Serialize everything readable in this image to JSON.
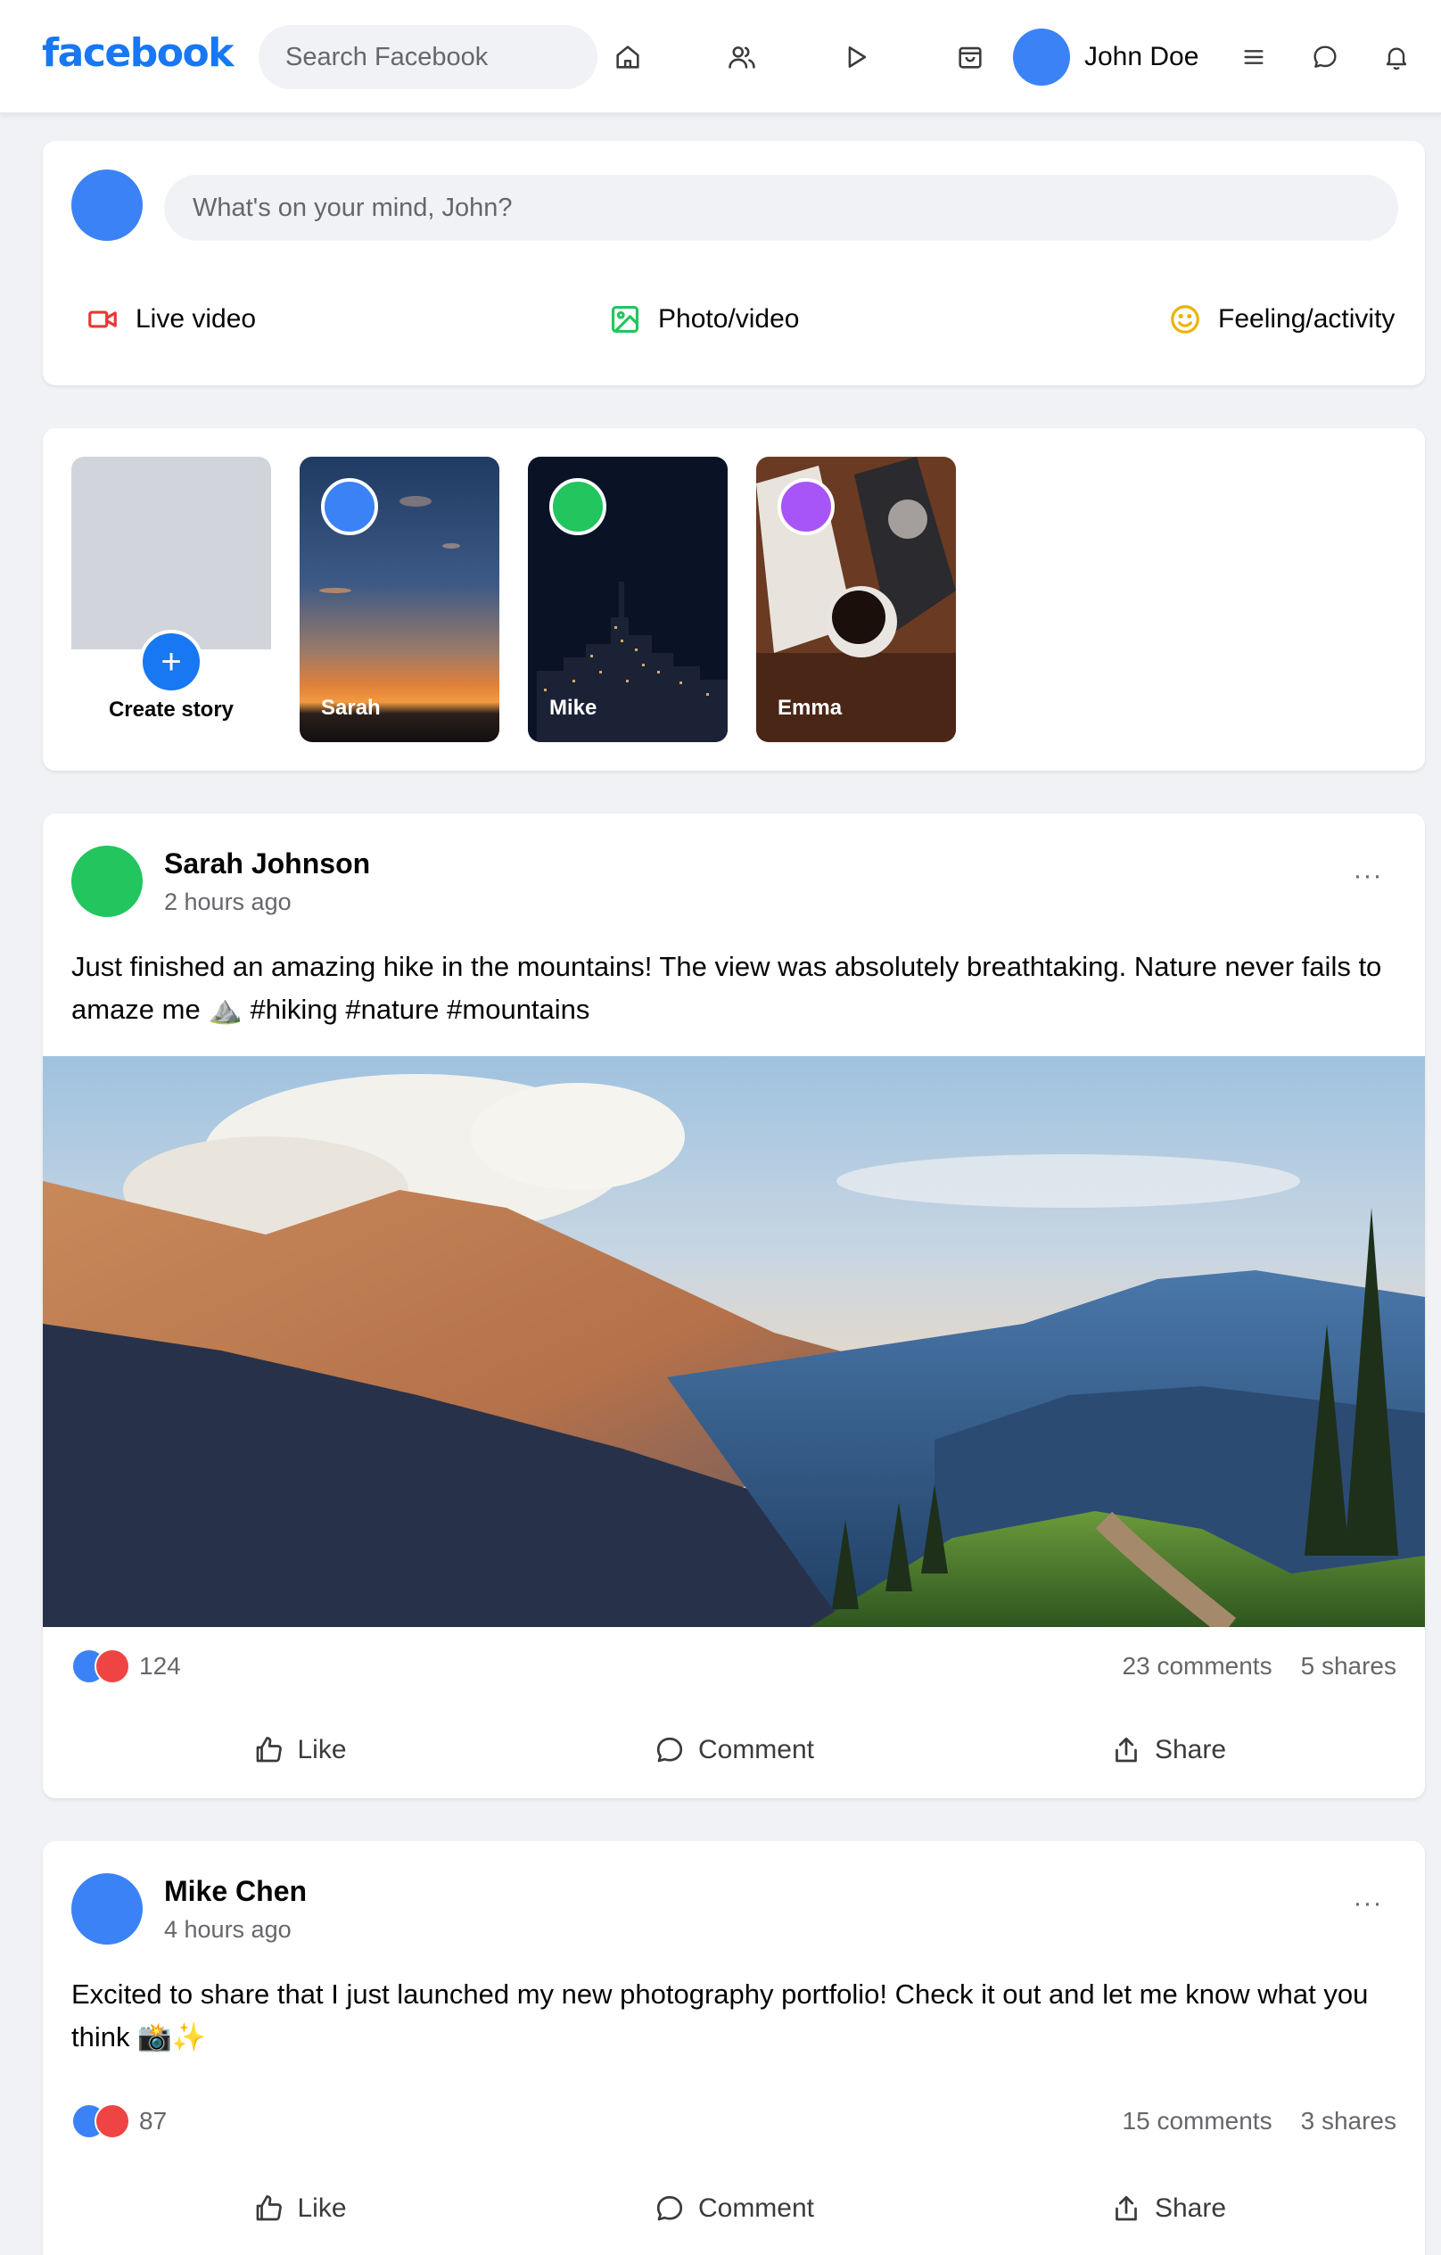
{
  "header": {
    "logo": "facebook",
    "search_placeholder": "Search Facebook",
    "user_name": "John Doe"
  },
  "composer": {
    "placeholder": "What's on your mind, John?",
    "actions": {
      "live": "Live video",
      "photo": "Photo/video",
      "feeling": "Feeling/activity"
    }
  },
  "stories": {
    "create_label": "Create story",
    "items": [
      {
        "name": "Sarah",
        "ring_color": "#3b82f6"
      },
      {
        "name": "Mike",
        "ring_color": "#22c55e"
      },
      {
        "name": "Emma",
        "ring_color": "#a855f7"
      }
    ]
  },
  "posts": [
    {
      "author": "Sarah Johnson",
      "time": "2 hours ago",
      "text": "Just finished an amazing hike in the mountains! The view was absolutely breathtaking. Nature never fails to amaze me ⛰️ #hiking #nature #mountains",
      "avatar_color": "#22c55e",
      "reactions": "124",
      "comments": "23 comments",
      "shares": "5 shares"
    },
    {
      "author": "Mike Chen",
      "time": "4 hours ago",
      "text": "Excited to share that I just launched my new photography portfolio! Check it out and let me know what you think 📸✨",
      "avatar_color": "#3b82f6",
      "reactions": "87",
      "comments": "15 comments",
      "shares": "3 shares"
    }
  ],
  "post_actions": {
    "like": "Like",
    "comment": "Comment",
    "share": "Share"
  },
  "more_label": "···",
  "colors": {
    "brand": "#1877f2",
    "live_icon": "#e53935",
    "photo_icon": "#22c55e",
    "feeling_icon": "#eab308"
  }
}
